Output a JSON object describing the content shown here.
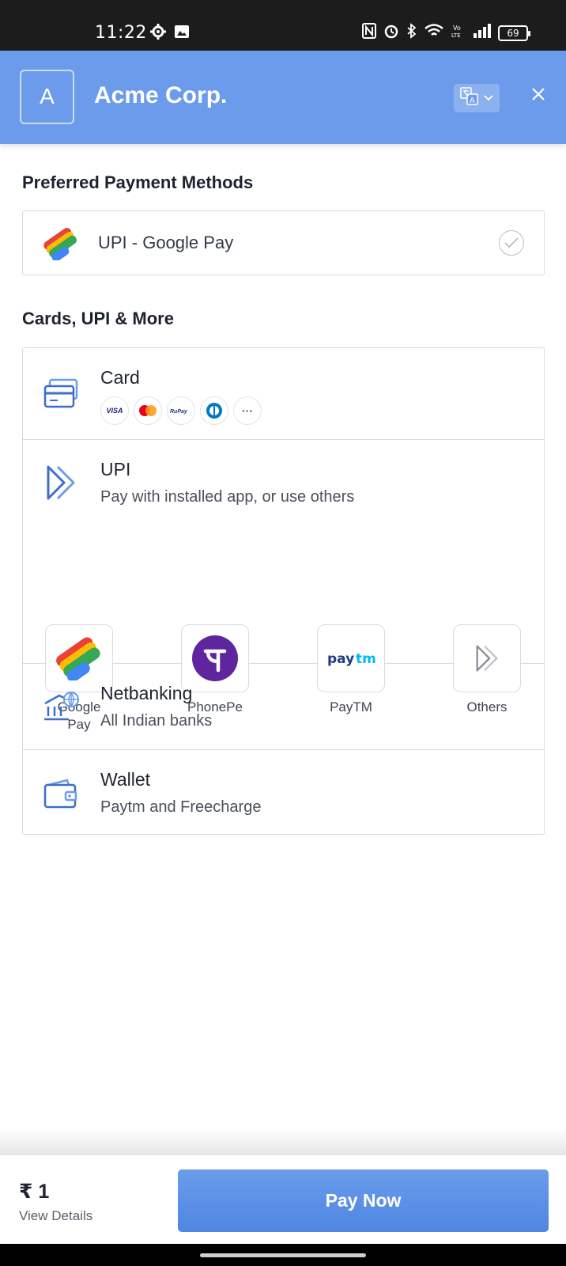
{
  "status_bar": {
    "time": "11:22",
    "battery": "69",
    "icons": [
      "settings-icon",
      "image-icon",
      "nfc-icon",
      "alarm-icon",
      "bluetooth-icon",
      "wifi-icon",
      "volte-icon",
      "signal-icon",
      "battery-icon"
    ]
  },
  "header": {
    "logo_letter": "A",
    "merchant_name": "Acme Corp.",
    "bg_color": "#6b9bea"
  },
  "preferred": {
    "title": "Preferred Payment Methods",
    "item_label": "UPI - Google Pay"
  },
  "methods": {
    "title": "Cards, UPI & More",
    "card": {
      "title": "Card",
      "badges": [
        "VISA",
        "Mastercard",
        "RuPay",
        "Diners",
        "···"
      ]
    },
    "upi": {
      "title": "UPI",
      "subtitle": "Pay with installed app, or use others",
      "apps": [
        {
          "label": "Google Pay"
        },
        {
          "label": "PhonePe"
        },
        {
          "label": "PayTM"
        },
        {
          "label": "Others"
        }
      ]
    },
    "netbanking": {
      "title": "Netbanking",
      "subtitle": "All Indian banks"
    },
    "wallet": {
      "title": "Wallet",
      "subtitle": "Paytm and Freecharge"
    }
  },
  "footer": {
    "amount": "₹ 1",
    "view_details": "View Details",
    "pay_button": "Pay Now"
  },
  "colors": {
    "accent": "#5a8fe6",
    "icon_blue": "#3b6fc9"
  }
}
